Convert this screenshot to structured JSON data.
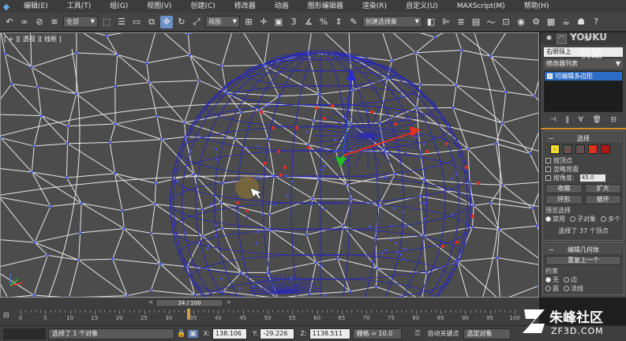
{
  "menu": {
    "items": [
      "编辑(E)",
      "工具(T)",
      "组(G)",
      "视图(V)",
      "创建(C)",
      "修改器",
      "动画",
      "图形编辑器",
      "渲染(R)",
      "自定义(U)",
      "MAXScript(M)",
      "帮助(H)"
    ]
  },
  "toolbar": {
    "filter_select": "全部",
    "coord_select": "视图",
    "selection_set": "创建选择集",
    "spinner_snap": "3",
    "percent_snap": "%"
  },
  "viewport": {
    "label": "[ + ][ 透视 ][ 线框 ]"
  },
  "panel": {
    "object_name": "右眼珠上",
    "modifier_list": "修改器列表",
    "stack_item": "可编辑多边形",
    "selection_title": "选择",
    "by_vertex": "按顶点",
    "ignore_backfacing": "忽略背面",
    "by_angle": "按角度:",
    "angle_value": "45.0",
    "shrink": "收缩",
    "grow": "扩大",
    "ring": "环形",
    "loop": "循环",
    "preview_title": "预览选择",
    "preview_off": "禁用",
    "preview_subobj": "子对象",
    "preview_multi": "多个",
    "selected_status": "选择了 37 个顶点",
    "edit_geometry_title": "编辑几何体",
    "repeat_last": "重复上一个",
    "constraints_title": "约束",
    "constraint_none": "无",
    "constraint_edge": "边",
    "constraint_face": "面",
    "constraint_normal": "法线"
  },
  "timeline": {
    "slider_text": "34 / 100",
    "current_frame": 34,
    "total_frames": 100,
    "ticks": [
      "0",
      "5",
      "10",
      "15",
      "20",
      "25",
      "30",
      "35",
      "40",
      "45",
      "50",
      "55",
      "60",
      "65",
      "70",
      "75",
      "80",
      "85",
      "90",
      "95",
      "100"
    ]
  },
  "status": {
    "selected": "选择了 1 个对象",
    "x_label": "X:",
    "x_value": "138.106",
    "y_label": "Y:",
    "y_value": "-29.226",
    "z_label": "Z:",
    "z_value": "1138.511",
    "grid": "栅格 = 10.0",
    "autokey": "自动关键点",
    "selected_objects": "选定对象"
  },
  "watermark": {
    "youku": "YOUKU",
    "youku_cn": "优酷",
    "zf3d_cn": "朱峰社区",
    "zf3d": "ZF3D.COM"
  },
  "colors": {
    "viewport_bg": "#4c4c4c",
    "wire_white": "#e8e8e8",
    "wire_blue": "#2a2ab0",
    "vertex_red": "#e03020",
    "accent_blue": "#2e6dc6"
  }
}
